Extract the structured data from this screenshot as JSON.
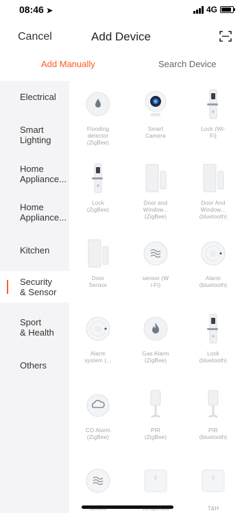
{
  "status": {
    "time": "08:46",
    "network": "4G"
  },
  "nav": {
    "cancel": "Cancel",
    "title": "Add Device"
  },
  "tabs": {
    "manual": "Add Manually",
    "search": "Search Device"
  },
  "sidebar": {
    "items": [
      {
        "label": "Electrical"
      },
      {
        "label": "Smart\nLighting"
      },
      {
        "label": "Home\nAppliance..."
      },
      {
        "label": "Home\nAppliance..."
      },
      {
        "label": "Kitchen"
      },
      {
        "label": "Security\n& Sensor"
      },
      {
        "label": "Sport\n& Health"
      },
      {
        "label": "Others"
      }
    ]
  },
  "devices": [
    {
      "label": "Flooding\ndetector\n(ZigBee)",
      "icon": "water-drop-icon"
    },
    {
      "label": "Smart\nCamera",
      "icon": "camera-icon"
    },
    {
      "label": "Lock (Wi-\nFi)",
      "icon": "door-lock-icon"
    },
    {
      "label": "Lock\n(ZigBee)",
      "icon": "door-lock-icon"
    },
    {
      "label": "Door and\nWindow...\n(ZigBee)",
      "icon": "door-window-sensor-icon"
    },
    {
      "label": "Door And\nWindow...\n(bluetooth)",
      "icon": "door-window-sensor-icon"
    },
    {
      "label": "Door\nSensor",
      "icon": "door-window-sensor-icon"
    },
    {
      "label": "sensor (W\ni-Fi)",
      "icon": "gas-sensor-icon"
    },
    {
      "label": "Alarm\n(bluetooth)",
      "icon": "smoke-alarm-icon"
    },
    {
      "label": "Alarm\nsystem (...",
      "icon": "smoke-alarm-icon"
    },
    {
      "label": "Gas Alarm\n(ZigBee)",
      "icon": "flame-icon"
    },
    {
      "label": "Lock\n(bluetooth)",
      "icon": "door-lock-icon"
    },
    {
      "label": "CO Alarm\n(ZigBee)",
      "icon": "co-alarm-icon"
    },
    {
      "label": "PIR\n(ZigBee)",
      "icon": "pir-sensor-icon"
    },
    {
      "label": "PIR\n(bluetooth)",
      "icon": "pir-sensor-icon"
    },
    {
      "label": "Smoke",
      "icon": "gas-sensor-icon"
    },
    {
      "label": "Temperatu",
      "icon": "temperature-humidity-icon"
    },
    {
      "label": "T&H",
      "icon": "temperature-humidity-icon"
    }
  ],
  "colors": {
    "accent": "#ff5a1f",
    "sidebar_bg": "#f4f4f6",
    "label_gray": "#a5a5a5"
  }
}
